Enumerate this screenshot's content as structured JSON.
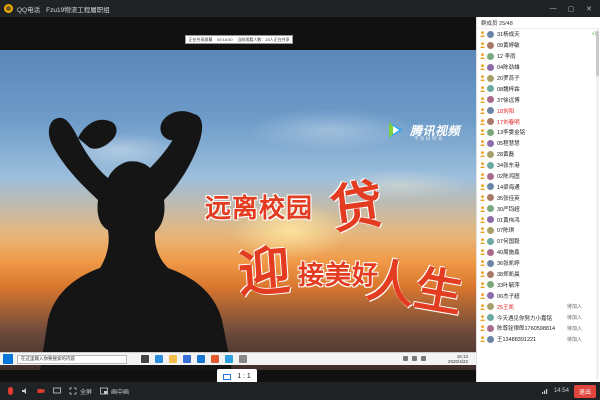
{
  "window": {
    "app_name": "QQ电话",
    "group_name": "Fzu19物流工程履职组",
    "controls": [
      "—",
      "▢",
      "✕"
    ]
  },
  "shared_screen": {
    "top_strip": [
      "正在共享屏幕",
      "00:16:00",
      "当前观看人数：25人正在共享"
    ],
    "brand_name": "腾讯视频",
    "brand_sub": "不负好时光",
    "slogan_line1": "远离校园",
    "slogan_char1": "贷",
    "slogan_char2": "迎",
    "slogan_line2": "接美好",
    "slogan_char3": "人生",
    "taskbar_search_placeholder": "在这里输入你要搜索的内容",
    "taskbar_time": "16:13",
    "taskbar_date": "2020/4/22"
  },
  "ratio_label": "1 : 1",
  "toolbar": {
    "fullscreen": "全屏",
    "pip": "画中画",
    "time": "14:54",
    "exit": "退出"
  },
  "members": {
    "header": "群成员 25/48",
    "items": [
      {
        "name": "31杨成天",
        "state": "",
        "red": false,
        "speaking": true
      },
      {
        "name": "09黄婷敏",
        "state": "",
        "red": false,
        "speaking": false
      },
      {
        "name": "12 李雨",
        "state": "",
        "red": false,
        "speaking": false
      },
      {
        "name": "04陈劲雄",
        "state": "",
        "red": false,
        "speaking": false
      },
      {
        "name": "20罗蕊子",
        "state": "",
        "red": false,
        "speaking": false
      },
      {
        "name": "08魏梓霖",
        "state": "",
        "red": false,
        "speaking": false
      },
      {
        "name": "37徐远博",
        "state": "",
        "red": false,
        "speaking": false
      },
      {
        "name": "18刘阳",
        "state": "",
        "red": true,
        "speaking": false
      },
      {
        "name": "17刘春明",
        "state": "",
        "red": true,
        "speaking": false
      },
      {
        "name": "13李雯金铭",
        "state": "",
        "red": false,
        "speaking": false
      },
      {
        "name": "05程慧慧",
        "state": "",
        "red": false,
        "speaking": false
      },
      {
        "name": "28黄磊",
        "state": "",
        "red": false,
        "speaking": false
      },
      {
        "name": "34张东港",
        "state": "",
        "red": false,
        "speaking": false
      },
      {
        "name": "02陈鸿图",
        "state": "",
        "red": false,
        "speaking": false
      },
      {
        "name": "14梁海通",
        "state": "",
        "red": false,
        "speaking": false
      },
      {
        "name": "35张佳英",
        "state": "",
        "red": false,
        "speaking": false
      },
      {
        "name": "30严钧超",
        "state": "",
        "red": false,
        "speaking": false
      },
      {
        "name": "01黄伟鸿",
        "state": "",
        "red": false,
        "speaking": false
      },
      {
        "name": "07陈琪",
        "state": "",
        "red": false,
        "speaking": false
      },
      {
        "name": "07何国毅",
        "state": "",
        "red": false,
        "speaking": false
      },
      {
        "name": "40周施鑫",
        "state": "",
        "red": false,
        "speaking": false
      },
      {
        "name": "36张凯婷",
        "state": "",
        "red": false,
        "speaking": false
      },
      {
        "name": "38郑凯晨",
        "state": "",
        "red": false,
        "speaking": false
      },
      {
        "name": "33叶毓萍",
        "state": "",
        "red": false,
        "speaking": false
      },
      {
        "name": "06杰子超",
        "state": "",
        "red": false,
        "speaking": false
      },
      {
        "name": "25王凯",
        "state": "待加入",
        "red": true,
        "speaking": false
      },
      {
        "name": "今天遇见你努力小嘉铭",
        "state": "待加入",
        "red": false,
        "speaking": false
      },
      {
        "name": "陈尊铨律郎1760598814",
        "state": "待加入",
        "red": false,
        "speaking": false
      },
      {
        "name": "王13488391221",
        "state": "待加入",
        "red": false,
        "speaking": false
      }
    ]
  },
  "colors": {
    "accent_red": "#e33c21",
    "title_bg": "#1f2326",
    "exit_red": "#e0463e"
  }
}
